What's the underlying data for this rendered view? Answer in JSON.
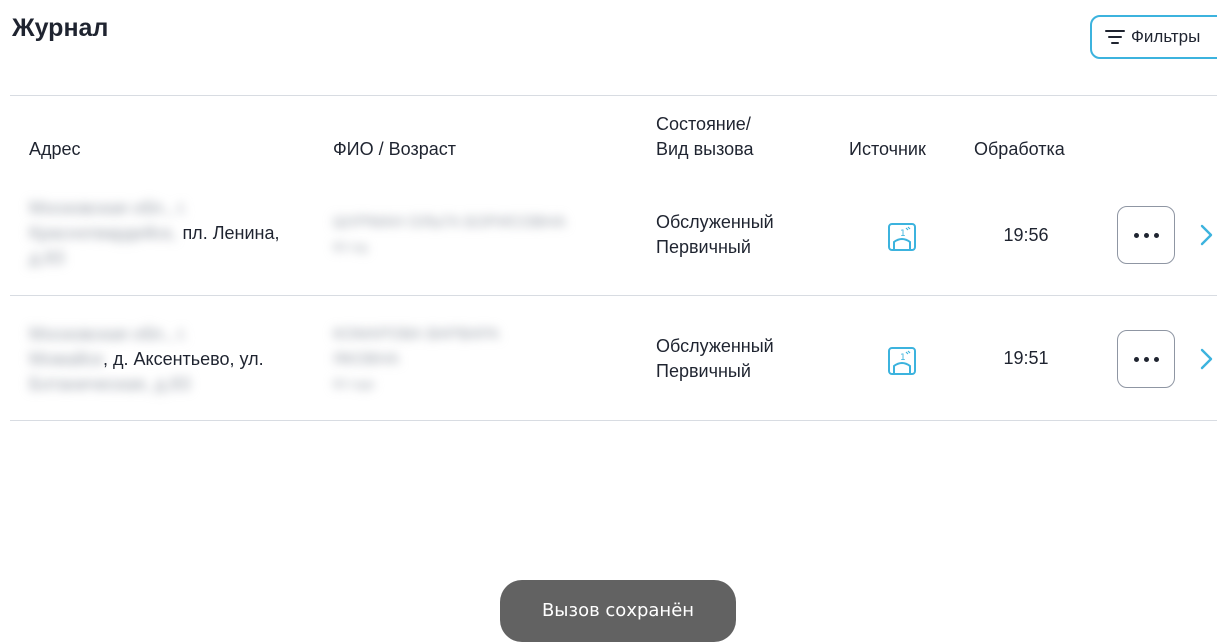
{
  "header": {
    "title": "Журнал",
    "filters_label": "Фильтры"
  },
  "table": {
    "columns": {
      "address": "Адрес",
      "name_age": "ФИО / Возраст",
      "status_line1": "Состояние/",
      "status_line2": "Вид вызова",
      "source": "Источник",
      "processing": "Обработка"
    },
    "rows": [
      {
        "address_line1": "Московская обл., г.",
        "address_line2_hidden": "Красногвардейск,",
        "address_line2_visible": "пл. Ленина,",
        "address_line3": "д.83",
        "name_line1": "ШУРМАН ОЛЬГА БОРИСОВНА",
        "name_line2": "83 год",
        "status": "Обслуженный",
        "call_type": "Первичный",
        "source_icon": "phone-tablet-icon",
        "time": "19:56"
      },
      {
        "address_line1": "Московская обл., г.",
        "address_line2_hidden": "Можайск",
        "address_line2_visible": ", д. Аксентьево, ул.",
        "address_line3": "Ботаническая, д.83",
        "name_line1": "КОМАРОВА ВАРВАРА",
        "name_line2": "ЯКОВНА",
        "name_line3": "83 года",
        "status": "Обслуженный",
        "call_type": "Первичный",
        "source_icon": "phone-tablet-icon",
        "time": "19:51"
      }
    ]
  },
  "toast": {
    "message": "Вызов сохранён"
  },
  "colors": {
    "accent": "#3cb3de",
    "text": "#1f2430",
    "divider": "#d8dce2",
    "toast_bg": "#626262"
  }
}
